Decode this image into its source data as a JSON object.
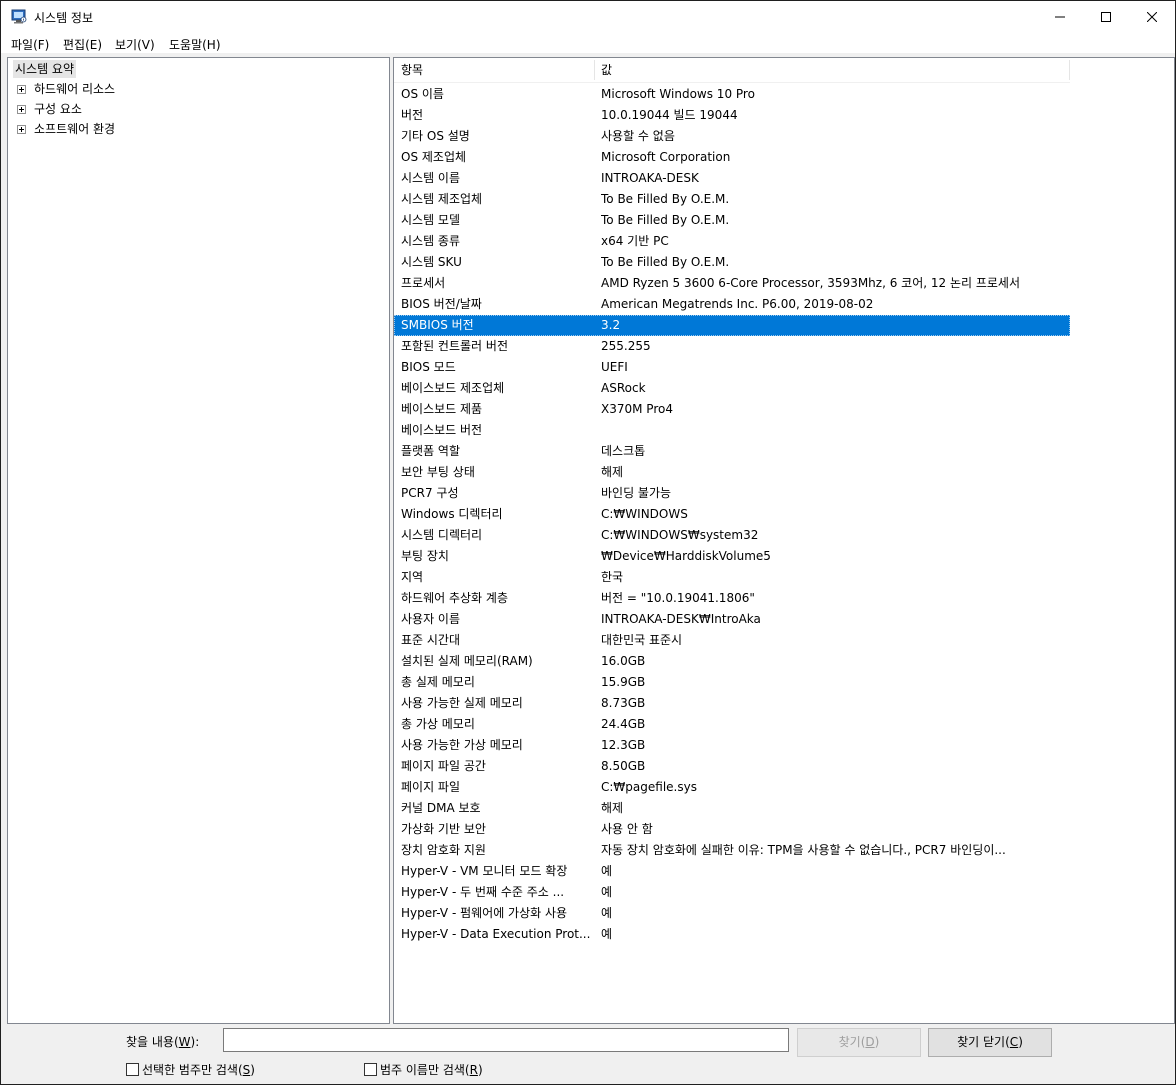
{
  "window": {
    "title": "시스템 정보",
    "controls": {
      "minimize": "minimize",
      "maximize": "maximize",
      "close": "close"
    }
  },
  "menu": [
    {
      "label": "파일(F)"
    },
    {
      "label": "편집(E)"
    },
    {
      "label": "보기(V)"
    },
    {
      "label": "도움말(H)"
    }
  ],
  "tree": {
    "root": "시스템 요약",
    "children": [
      {
        "label": "하드웨어 리소스"
      },
      {
        "label": "구성 요소"
      },
      {
        "label": "소프트웨어 환경"
      }
    ]
  },
  "table": {
    "headers": {
      "item": "항목",
      "value": "값"
    },
    "selected_index": 11,
    "rows": [
      {
        "item": "OS 이름",
        "value": "Microsoft Windows 10 Pro"
      },
      {
        "item": "버전",
        "value": "10.0.19044 빌드 19044"
      },
      {
        "item": "기타 OS 설명",
        "value": "사용할 수 없음"
      },
      {
        "item": "OS 제조업체",
        "value": "Microsoft Corporation"
      },
      {
        "item": "시스템 이름",
        "value": "INTROAKA-DESK"
      },
      {
        "item": "시스템 제조업체",
        "value": "To Be Filled By O.E.M."
      },
      {
        "item": "시스템 모델",
        "value": "To Be Filled By O.E.M."
      },
      {
        "item": "시스템 종류",
        "value": "x64 기반 PC"
      },
      {
        "item": "시스템 SKU",
        "value": "To Be Filled By O.E.M."
      },
      {
        "item": "프로세서",
        "value": "AMD Ryzen 5 3600 6-Core Processor, 3593Mhz, 6 코어, 12 논리 프로세서"
      },
      {
        "item": "BIOS 버전/날짜",
        "value": "American Megatrends Inc. P6.00, 2019-08-02"
      },
      {
        "item": "SMBIOS 버전",
        "value": "3.2"
      },
      {
        "item": "포함된 컨트롤러 버전",
        "value": "255.255"
      },
      {
        "item": "BIOS 모드",
        "value": "UEFI"
      },
      {
        "item": "베이스보드 제조업체",
        "value": "ASRock"
      },
      {
        "item": "베이스보드 제품",
        "value": "X370M Pro4"
      },
      {
        "item": "베이스보드 버전",
        "value": ""
      },
      {
        "item": "플랫폼 역할",
        "value": "데스크톱"
      },
      {
        "item": "보안 부팅 상태",
        "value": "해제"
      },
      {
        "item": "PCR7 구성",
        "value": "바인딩 불가능"
      },
      {
        "item": "Windows 디렉터리",
        "value": "C:₩WINDOWS"
      },
      {
        "item": "시스템 디렉터리",
        "value": "C:₩WINDOWS₩system32"
      },
      {
        "item": "부팅 장치",
        "value": "₩Device₩HarddiskVolume5"
      },
      {
        "item": "지역",
        "value": "한국"
      },
      {
        "item": "하드웨어 추상화 계층",
        "value": "버전 = \"10.0.19041.1806\""
      },
      {
        "item": "사용자 이름",
        "value": "INTROAKA-DESK₩IntroAka"
      },
      {
        "item": "표준 시간대",
        "value": "대한민국 표준시"
      },
      {
        "item": "설치된 실제 메모리(RAM)",
        "value": "16.0GB"
      },
      {
        "item": "총 실제 메모리",
        "value": "15.9GB"
      },
      {
        "item": "사용 가능한 실제 메모리",
        "value": "8.73GB"
      },
      {
        "item": "총 가상 메모리",
        "value": "24.4GB"
      },
      {
        "item": "사용 가능한 가상 메모리",
        "value": "12.3GB"
      },
      {
        "item": "페이지 파일 공간",
        "value": "8.50GB"
      },
      {
        "item": "페이지 파일",
        "value": "C:₩pagefile.sys"
      },
      {
        "item": "커널 DMA 보호",
        "value": "해제"
      },
      {
        "item": "가상화 기반 보안",
        "value": "사용 안 함"
      },
      {
        "item": "장치 암호화 지원",
        "value": "자동 장치 암호화에 실패한 이유: TPM을 사용할 수 없습니다., PCR7 바인딩이..."
      },
      {
        "item": "Hyper-V - VM 모니터 모드 확장",
        "value": "예"
      },
      {
        "item": "Hyper-V - 두 번째 수준 주소 ...",
        "value": "예"
      },
      {
        "item": "Hyper-V - 펌웨어에 가상화 사용",
        "value": "예"
      },
      {
        "item": "Hyper-V - Data Execution Prot...",
        "value": "예"
      }
    ]
  },
  "find": {
    "label_prefix": "찾을 내용(",
    "label_key": "W",
    "label_suffix": "):",
    "input_value": "",
    "find_button_prefix": "찾기(",
    "find_button_key": "D",
    "find_button_suffix": ")",
    "close_button_prefix": "찾기 닫기(",
    "close_button_key": "C",
    "close_button_suffix": ")",
    "checkbox_selected_prefix": "선택한 범주만 검색(",
    "checkbox_selected_key": "S",
    "checkbox_selected_suffix": ")",
    "checkbox_category_prefix": "범주 이름만 검색(",
    "checkbox_category_key": "R",
    "checkbox_category_suffix": ")"
  }
}
